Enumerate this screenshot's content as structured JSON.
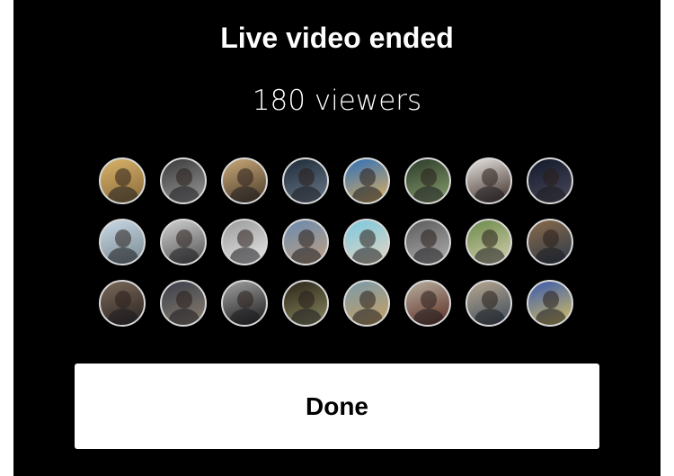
{
  "title": "Live video ended",
  "viewer_count_label": "180 viewers",
  "done_label": "Done",
  "avatars": [
    {
      "bg": "#d8b36a",
      "bg2": "#8a6a3a"
    },
    {
      "bg": "#3a3a3a",
      "bg2": "#9a9a9a"
    },
    {
      "bg": "#c8a878",
      "bg2": "#4a3a2a"
    },
    {
      "bg": "#1e2a38",
      "bg2": "#6a7a8a"
    },
    {
      "bg": "#2e6fb8",
      "bg2": "#e0b060"
    },
    {
      "bg": "#2a3a28",
      "bg2": "#8aa070"
    },
    {
      "bg": "#e8e4e0",
      "bg2": "#3a2a24"
    },
    {
      "bg": "#12182a",
      "bg2": "#4a4a5a"
    },
    {
      "bg": "#c8d8e6",
      "bg2": "#7a8a90"
    },
    {
      "bg": "#d0d0d0",
      "bg2": "#505050"
    },
    {
      "bg": "#9a9a9a",
      "bg2": "#e8e8e8"
    },
    {
      "bg": "#6a8ab0",
      "bg2": "#c0a080"
    },
    {
      "bg": "#7ac8e0",
      "bg2": "#e6d6c0"
    },
    {
      "bg": "#5a5a5a",
      "bg2": "#b0b0b0"
    },
    {
      "bg": "#6a8a4a",
      "bg2": "#d8d0b0"
    },
    {
      "bg": "#8a6a4a",
      "bg2": "#2a3a4a"
    },
    {
      "bg": "#7a6a5a",
      "bg2": "#2a2220"
    },
    {
      "bg": "#3a3e4a",
      "bg2": "#8a8070"
    },
    {
      "bg": "#a0a0a0",
      "bg2": "#1a1a1a"
    },
    {
      "bg": "#2a2418",
      "bg2": "#8a8a60"
    },
    {
      "bg": "#7a9aaa",
      "bg2": "#c8a060"
    },
    {
      "bg": "#b8b0a0",
      "bg2": "#5a2a20"
    },
    {
      "bg": "#b8a890",
      "bg2": "#3a4a5a"
    },
    {
      "bg": "#3a5ab0",
      "bg2": "#d8c060"
    }
  ]
}
